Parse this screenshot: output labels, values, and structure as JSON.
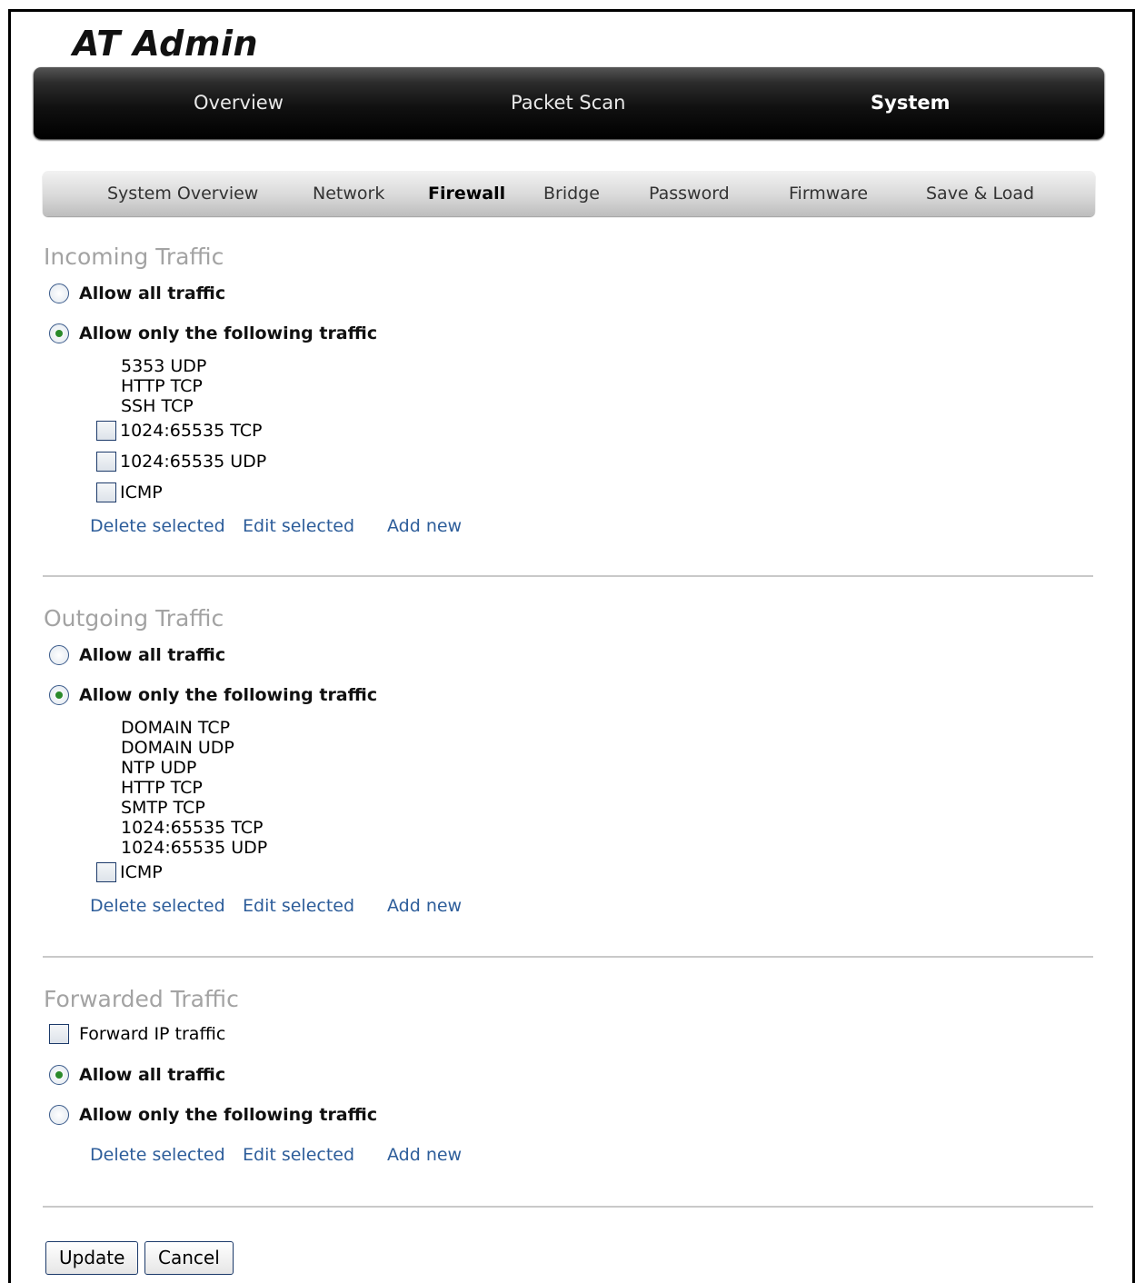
{
  "app_title": "AT Admin",
  "top_nav": {
    "tabs": [
      {
        "label": "Overview"
      },
      {
        "label": "Packet Scan"
      },
      {
        "label": "System"
      }
    ],
    "active": "System"
  },
  "sub_nav": {
    "tabs": [
      {
        "label": "System Overview"
      },
      {
        "label": "Network"
      },
      {
        "label": "Firewall"
      },
      {
        "label": "Bridge"
      },
      {
        "label": "Password"
      },
      {
        "label": "Firmware"
      },
      {
        "label": "Save & Load"
      }
    ],
    "active": "Firewall"
  },
  "incoming": {
    "title": "Incoming Traffic",
    "allow_all": {
      "label": "Allow all traffic",
      "selected": false
    },
    "allow_only": {
      "label": "Allow only the following traffic",
      "selected": true
    },
    "fixed_rules": [
      "5353 UDP",
      "HTTP TCP",
      "SSH TCP"
    ],
    "checkbox_rules": [
      {
        "label": "1024:65535 TCP",
        "checked": false
      },
      {
        "label": "1024:65535 UDP",
        "checked": false
      },
      {
        "label": "ICMP",
        "checked": false
      }
    ],
    "actions": {
      "delete": "Delete selected",
      "edit": "Edit selected",
      "add": "Add new"
    }
  },
  "outgoing": {
    "title": "Outgoing Traffic",
    "allow_all": {
      "label": "Allow all traffic",
      "selected": false
    },
    "allow_only": {
      "label": "Allow only the following traffic",
      "selected": true
    },
    "fixed_rules": [
      "DOMAIN TCP",
      "DOMAIN UDP",
      "NTP UDP",
      "HTTP TCP",
      "SMTP TCP",
      "1024:65535 TCP",
      "1024:65535 UDP"
    ],
    "checkbox_rules": [
      {
        "label": "ICMP",
        "checked": false
      }
    ],
    "actions": {
      "delete": "Delete selected",
      "edit": "Edit selected",
      "add": "Add new"
    }
  },
  "forwarded": {
    "title": "Forwarded Traffic",
    "forward_ip": {
      "label": "Forward IP traffic",
      "checked": false
    },
    "allow_all": {
      "label": "Allow all traffic",
      "selected": true
    },
    "allow_only": {
      "label": "Allow only the following traffic",
      "selected": false
    },
    "actions": {
      "delete": "Delete selected",
      "edit": "Edit selected",
      "add": "Add new"
    }
  },
  "buttons": {
    "update": "Update",
    "cancel": "Cancel"
  },
  "colors": {
    "link": "#2d5d9a",
    "section_title": "#a3a3a3",
    "radio_dot": "#2a8a2a"
  }
}
